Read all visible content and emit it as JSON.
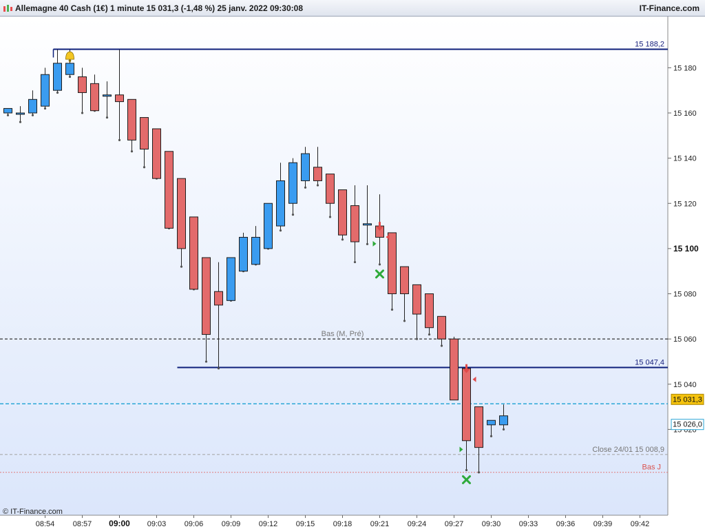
{
  "header": {
    "title": "Allemagne 40 Cash (1€) 1 minute 15 031,3 (-1,48 %) 25 janv. 2022 09:30:08",
    "brand": "IT-Finance.com"
  },
  "footer": {
    "copyright": "© IT-Finance.com"
  },
  "colors": {
    "up": "#3a9cf0",
    "down": "#e36b6b",
    "level": "#0d1f7a",
    "price": "#2aa6d6",
    "background_top": "#ffffff",
    "background_bottom": "#dbe6fb"
  },
  "icons": [
    "bell-icon",
    "sell-arrow-icon",
    "buy-cross-icon",
    "chart-logo-icon"
  ],
  "chart_data": {
    "type": "candlestick",
    "interval": "1 minute",
    "y_range": [
      15000,
      15192
    ],
    "y_ticks": [
      {
        "value": 15020,
        "label": "15 020"
      },
      {
        "value": 15040,
        "label": "15 040"
      },
      {
        "value": 15060,
        "label": "15 060"
      },
      {
        "value": 15080,
        "label": "15 080"
      },
      {
        "value": 15100,
        "label": "15 100",
        "bold": true
      },
      {
        "value": 15120,
        "label": "15 120"
      },
      {
        "value": 15140,
        "label": "15 140"
      },
      {
        "value": 15160,
        "label": "15 160"
      },
      {
        "value": 15180,
        "label": "15 180"
      }
    ],
    "x_ticks": [
      {
        "index": 3,
        "label": "08:54"
      },
      {
        "index": 6,
        "label": "08:57"
      },
      {
        "index": 9,
        "label": "09:00",
        "bold": true
      },
      {
        "index": 12,
        "label": "09:03"
      },
      {
        "index": 15,
        "label": "09:06"
      },
      {
        "index": 18,
        "label": "09:09"
      },
      {
        "index": 21,
        "label": "09:12"
      },
      {
        "index": 24,
        "label": "09:15"
      },
      {
        "index": 27,
        "label": "09:18"
      },
      {
        "index": 30,
        "label": "09:21"
      },
      {
        "index": 33,
        "label": "09:24"
      },
      {
        "index": 36,
        "label": "09:27"
      },
      {
        "index": 39,
        "label": "09:30"
      },
      {
        "index": 42,
        "label": "09:33"
      },
      {
        "index": 45,
        "label": "09:36"
      },
      {
        "index": 48,
        "label": "09:39"
      },
      {
        "index": 51,
        "label": "09:42"
      }
    ],
    "candles": [
      {
        "time": "08:51",
        "open": 15160,
        "high": 15162,
        "low": 15159,
        "close": 15162
      },
      {
        "time": "08:52",
        "open": 15160,
        "high": 15163,
        "low": 15156,
        "close": 15160
      },
      {
        "time": "08:53",
        "open": 15160,
        "high": 15170,
        "low": 15159,
        "close": 15166
      },
      {
        "time": "08:54",
        "open": 15163,
        "high": 15180,
        "low": 15162,
        "close": 15177
      },
      {
        "time": "08:55",
        "open": 15170,
        "high": 15188,
        "low": 15169,
        "close": 15182
      },
      {
        "time": "08:56",
        "open": 15177,
        "high": 15188,
        "low": 15176,
        "close": 15182
      },
      {
        "time": "08:57",
        "open": 15176,
        "high": 15180,
        "low": 15160,
        "close": 15169
      },
      {
        "time": "08:58",
        "open": 15173,
        "high": 15177,
        "low": 15161,
        "close": 15161
      },
      {
        "time": "08:59",
        "open": 15168,
        "high": 15174,
        "low": 15158,
        "close": 15168
      },
      {
        "time": "09:00",
        "open": 15168,
        "high": 15188,
        "low": 15148,
        "close": 15165
      },
      {
        "time": "09:01",
        "open": 15166,
        "high": 15166,
        "low": 15143,
        "close": 15148
      },
      {
        "time": "09:02",
        "open": 15158,
        "high": 15158,
        "low": 15136,
        "close": 15144
      },
      {
        "time": "09:03",
        "open": 15153,
        "high": 15153,
        "low": 15131,
        "close": 15131
      },
      {
        "time": "09:04",
        "open": 15143,
        "high": 15143,
        "low": 15109,
        "close": 15109
      },
      {
        "time": "09:05",
        "open": 15131,
        "high": 15131,
        "low": 15092,
        "close": 15100
      },
      {
        "time": "09:06",
        "open": 15114,
        "high": 15114,
        "low": 15082,
        "close": 15082
      },
      {
        "time": "09:07",
        "open": 15096,
        "high": 15096,
        "low": 15050,
        "close": 15062
      },
      {
        "time": "09:08",
        "open": 15081,
        "high": 15094,
        "low": 15047,
        "close": 15075
      },
      {
        "time": "09:09",
        "open": 15077,
        "high": 15096,
        "low": 15077,
        "close": 15096
      },
      {
        "time": "09:10",
        "open": 15090,
        "high": 15107,
        "low": 15090,
        "close": 15105
      },
      {
        "time": "09:11",
        "open": 15093,
        "high": 15110,
        "low": 15093,
        "close": 15105
      },
      {
        "time": "09:12",
        "open": 15100,
        "high": 15120,
        "low": 15100,
        "close": 15120
      },
      {
        "time": "09:13",
        "open": 15110,
        "high": 15138,
        "low": 15108,
        "close": 15130
      },
      {
        "time": "09:14",
        "open": 15120,
        "high": 15140,
        "low": 15115,
        "close": 15138
      },
      {
        "time": "09:15",
        "open": 15130,
        "high": 15145,
        "low": 15127,
        "close": 15142
      },
      {
        "time": "09:16",
        "open": 15136,
        "high": 15145,
        "low": 15128,
        "close": 15130
      },
      {
        "time": "09:17",
        "open": 15133,
        "high": 15133,
        "low": 15114,
        "close": 15120
      },
      {
        "time": "09:18",
        "open": 15126,
        "high": 15126,
        "low": 15104,
        "close": 15106
      },
      {
        "time": "09:19",
        "open": 15119,
        "high": 15128,
        "low": 15094,
        "close": 15103
      },
      {
        "time": "09:20",
        "open": 15111,
        "high": 15128,
        "low": 15102,
        "close": 15111
      },
      {
        "time": "09:21",
        "open": 15110,
        "high": 15124,
        "low": 15093,
        "close": 15105
      },
      {
        "time": "09:22",
        "open": 15107,
        "high": 15107,
        "low": 15073,
        "close": 15080
      },
      {
        "time": "09:23",
        "open": 15092,
        "high": 15092,
        "low": 15068,
        "close": 15080
      },
      {
        "time": "09:24",
        "open": 15084,
        "high": 15084,
        "low": 15060,
        "close": 15071
      },
      {
        "time": "09:25",
        "open": 15080,
        "high": 15080,
        "low": 15062,
        "close": 15065
      },
      {
        "time": "09:26",
        "open": 15070,
        "high": 15070,
        "low": 15057,
        "close": 15060
      },
      {
        "time": "09:27",
        "open": 15060,
        "high": 15061,
        "low": 15040,
        "close": 15033
      },
      {
        "time": "09:28",
        "open": 15047,
        "high": 15048,
        "low": 15002,
        "close": 15015
      },
      {
        "time": "09:29",
        "open": 15030,
        "high": 15030,
        "low": 15001,
        "close": 15012
      },
      {
        "time": "09:30",
        "open": 15022,
        "high": 15024,
        "low": 15017,
        "close": 15024
      },
      {
        "time": "09:31",
        "open": 15022,
        "high": 15031,
        "low": 15020,
        "close": 15026
      }
    ],
    "horizontal_lines": [
      {
        "value": 15188.2,
        "label": "15 188,2",
        "style": "solid"
      },
      {
        "value": 15047.4,
        "label": "15 047,4",
        "style": "solid"
      },
      {
        "value": 15060,
        "label": "Bas (M, Pré)",
        "style": "dashed"
      },
      {
        "value": 15031.3,
        "label": "",
        "style": "price"
      },
      {
        "value": 15008.9,
        "label": "Close 24/01 15 008,9",
        "style": "dashed"
      },
      {
        "value": 15001,
        "label": "Bas J",
        "style": "dotted"
      }
    ],
    "price_tags": [
      {
        "value": 15031.3,
        "label": "15 031,3",
        "role": "last"
      },
      {
        "value": 15026.0,
        "label": "15 026,0",
        "role": "open"
      }
    ],
    "signals": [
      {
        "time": "08:56",
        "type": "alert"
      },
      {
        "time": "09:21",
        "type": "sell"
      },
      {
        "time": "09:21",
        "type": "buy"
      },
      {
        "time": "09:28",
        "type": "sell"
      },
      {
        "time": "09:28",
        "type": "buy"
      }
    ]
  }
}
